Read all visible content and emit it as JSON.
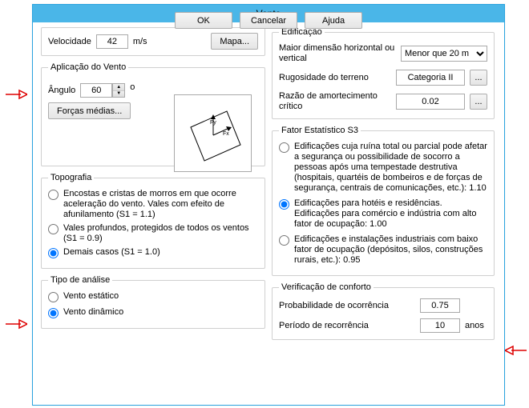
{
  "window": {
    "title": "Vento"
  },
  "velocity": {
    "label": "Velocidade",
    "value": "42",
    "unit": "m/s",
    "map_btn": "Mapa..."
  },
  "application": {
    "legend": "Aplicação do Vento",
    "angle_label": "Ângulo",
    "angle_value": "60",
    "degree": "o",
    "forces_btn": "Forças médias..."
  },
  "topography": {
    "legend": "Topografia",
    "opt1": "Encostas e cristas de morros em que ocorre aceleração do vento. Vales com efeito de afunilamento (S1 = 1.1)",
    "opt2": "Vales profundos, protegidos de todos os ventos (S1 = 0.9)",
    "opt3": "Demais casos (S1 = 1.0)"
  },
  "analysis": {
    "legend": "Tipo de análise",
    "opt1": "Vento estático",
    "opt2": "Vento dinâmico"
  },
  "building": {
    "legend": "Edificação",
    "maj_label": "Maior dimensão horizontal ou vertical",
    "maj_value": "Menor que 20 m",
    "terrain_label": "Rugosidade do terreno",
    "terrain_value": "Categoria II",
    "damp_label": "Razão de amortecimento crítico",
    "damp_value": "0.02",
    "dots": "..."
  },
  "stat_factor": {
    "legend": "Fator Estatístico S3",
    "opt1": "Edificações cuja ruína total ou parcial pode afetar a segurança ou possibilidade de socorro a pessoas após uma tempestade destrutiva (hospitais, quartéis de bombeiros e de forças de segurança, centrais de comunicações, etc.): 1.10",
    "opt2": "Edificações para hotéis e residências. Edificações para comércio e indústria com alto fator de ocupação: 1.00",
    "opt3": "Edificações e instalações industriais com baixo fator de ocupação (depósitos, silos, construções rurais, etc.): 0.95"
  },
  "comfort": {
    "legend": "Verificação de conforto",
    "prob_label": "Probabilidade de ocorrência",
    "prob_value": "0.75",
    "period_label": "Período de recorrência",
    "period_value": "10",
    "period_unit": "anos"
  },
  "buttons": {
    "ok": "OK",
    "cancel": "Cancelar",
    "help": "Ajuda"
  }
}
